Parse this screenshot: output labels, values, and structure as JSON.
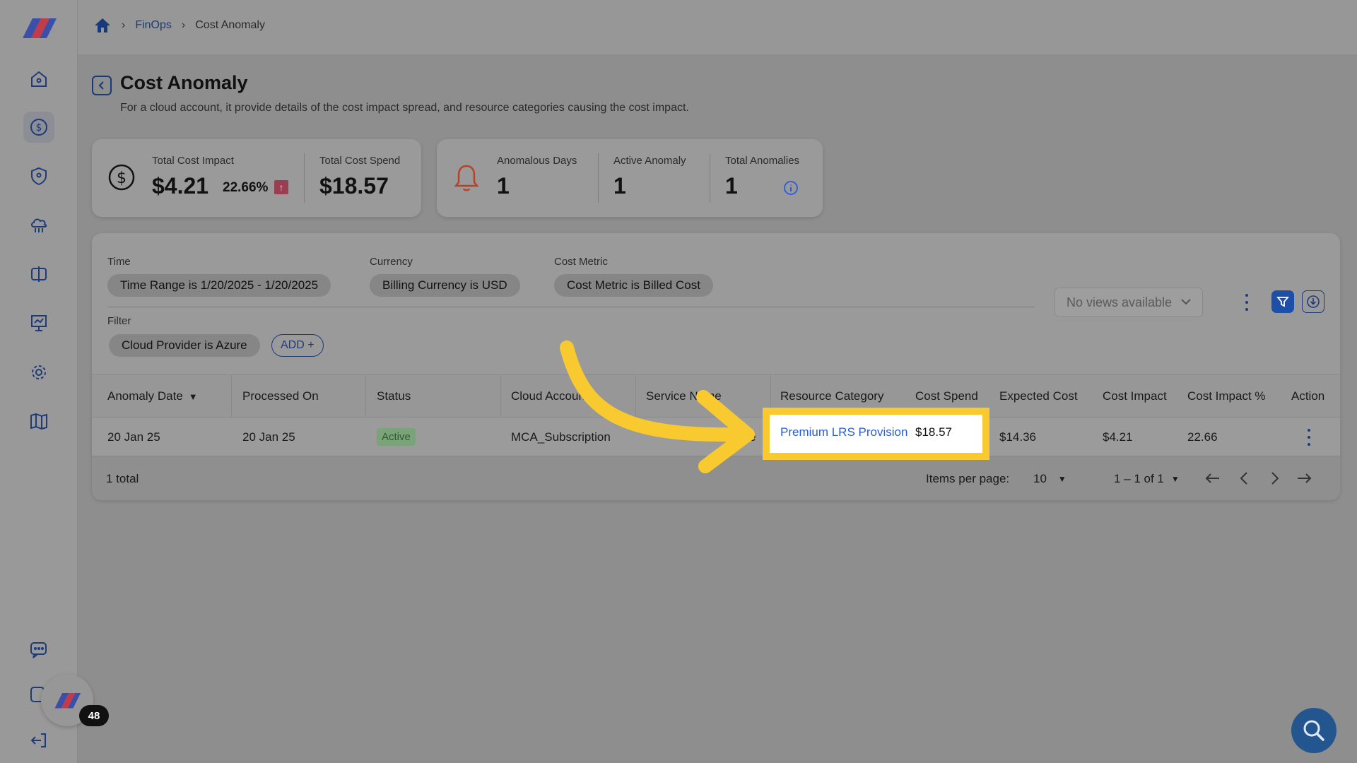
{
  "breadcrumb": {
    "finops": "FinOps",
    "current": "Cost Anomaly"
  },
  "page": {
    "title": "Cost Anomaly",
    "subtitle": "For a cloud account, it provide details of the cost impact spread, and resource categories causing the cost impact."
  },
  "summary": {
    "total_cost_impact_label": "Total Cost Impact",
    "total_cost_impact_value": "$4.21",
    "total_cost_impact_pct": "22.66%",
    "total_cost_spend_label": "Total Cost Spend",
    "total_cost_spend_value": "$18.57",
    "anomalous_days_label": "Anomalous Days",
    "anomalous_days_value": "1",
    "active_anomaly_label": "Active Anomaly",
    "active_anomaly_value": "1",
    "total_anomalies_label": "Total Anomalies",
    "total_anomalies_value": "1"
  },
  "filters": {
    "time_label": "Time",
    "time_chip": "Time Range is 1/20/2025 - 1/20/2025",
    "currency_label": "Currency",
    "currency_chip": "Billing Currency is USD",
    "metric_label": "Cost Metric",
    "metric_chip": "Cost Metric is Billed Cost",
    "filter_label": "Filter",
    "filter_chip": "Cloud Provider is Azure",
    "add_label": "ADD +",
    "views_placeholder": "No views available"
  },
  "table": {
    "headers": {
      "anomaly_date": "Anomaly Date",
      "processed_on": "Processed On",
      "status": "Status",
      "cloud_account": "Cloud Accoun",
      "service_name": "Service Name",
      "resource_category": "Resource Category",
      "cost_spend": "Cost Spend",
      "expected_cost": "Expected Cost",
      "cost_impact": "Cost Impact",
      "cost_impact_pct": "Cost Impact %",
      "action": "Action"
    },
    "row": {
      "anomaly_date": "20 Jan 25",
      "processed_on": "20 Jan 25",
      "status": "Active",
      "cloud_account": "MCA_Subscription",
      "service_name_fragment": "e",
      "resource_category": "Premium LRS Provision",
      "cost_spend": "$18.57",
      "expected_cost": "$14.36",
      "cost_impact": "$4.21",
      "cost_impact_pct": "22.66"
    },
    "footer": {
      "total": "1 total",
      "items_per_page_label": "Items per page:",
      "items_per_page_value": "10",
      "range": "1 – 1 of 1"
    }
  },
  "notification_count": "48",
  "colors": {
    "highlight": "#f8ca2f",
    "brand_blue": "#1e3a78",
    "link": "#2a5bd7"
  }
}
